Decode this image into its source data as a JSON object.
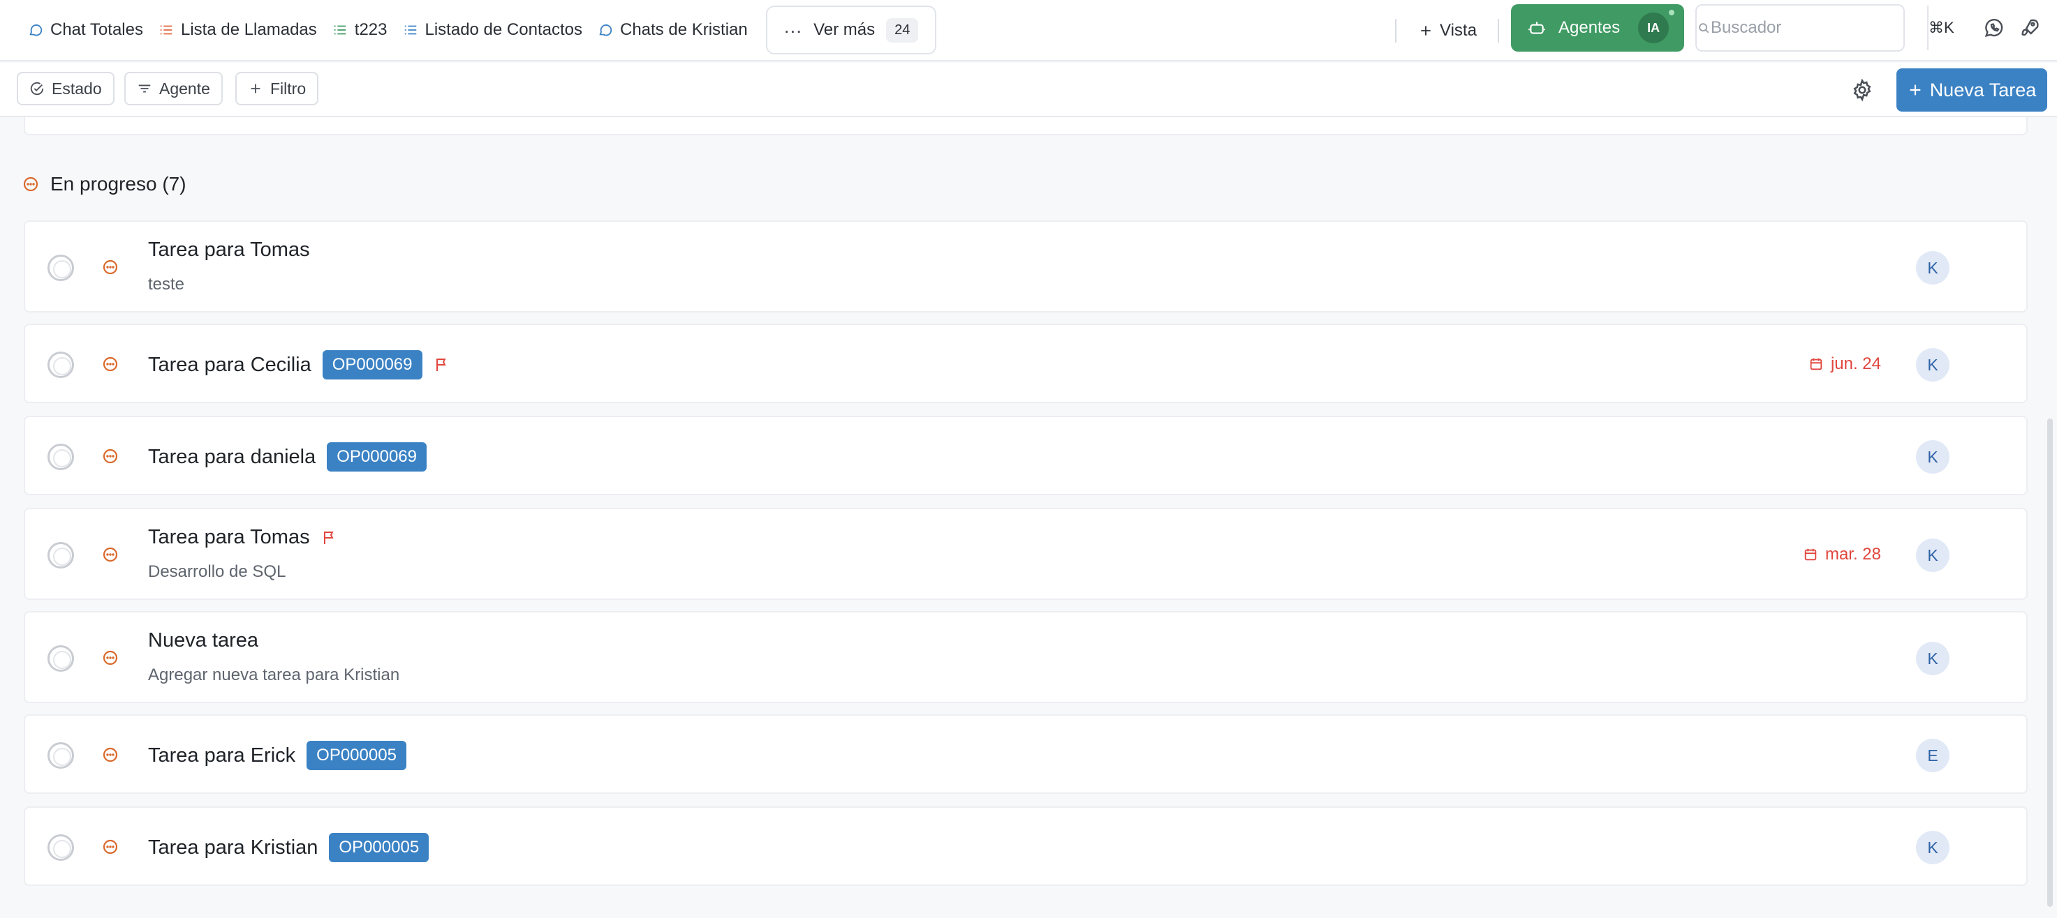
{
  "tabs": [
    {
      "label": "Chat Totales",
      "icon": "chat-icon",
      "color": "#3b82c4"
    },
    {
      "label": "Lista de Llamadas",
      "icon": "list-icon",
      "color": "#e0663e"
    },
    {
      "label": "t223",
      "icon": "list-icon",
      "color": "#3f9a63"
    },
    {
      "label": "Listado de Contactos",
      "icon": "list-icon",
      "color": "#3b82c4"
    },
    {
      "label": "Chats de Kristian",
      "icon": "chat-icon",
      "color": "#3b82c4"
    }
  ],
  "more": {
    "label": "Ver más",
    "count": "24"
  },
  "vista": {
    "label": "Vista"
  },
  "agentes": {
    "label": "Agentes",
    "badge": "IA"
  },
  "search": {
    "placeholder": "Buscador",
    "shortcut": "⌘K"
  },
  "filters": {
    "estado": "Estado",
    "agente": "Agente",
    "filtro": "Filtro"
  },
  "new_task": {
    "label": "Nueva Tarea"
  },
  "group": {
    "title": "En progreso (7)",
    "status_color": "#d9692b"
  },
  "tasks": [
    {
      "title": "Tarea para Tomas",
      "tag": "",
      "flag": false,
      "description": "teste",
      "date": "",
      "assignee": "K"
    },
    {
      "title": "Tarea para Cecilia",
      "tag": "OP000069",
      "flag": true,
      "description": "",
      "date": "jun. 24",
      "assignee": "K"
    },
    {
      "title": "Tarea para daniela",
      "tag": "OP000069",
      "flag": false,
      "description": "",
      "date": "",
      "assignee": "K"
    },
    {
      "title": "Tarea para Tomas",
      "tag": "",
      "flag": true,
      "description": "Desarrollo de SQL",
      "date": "mar. 28",
      "assignee": "K"
    },
    {
      "title": "Nueva tarea",
      "tag": "",
      "flag": false,
      "description": "Agregar nueva tarea para Kristian",
      "date": "",
      "assignee": "K"
    },
    {
      "title": "Tarea para Erick",
      "tag": "OP000005",
      "flag": false,
      "description": "",
      "date": "",
      "assignee": "E"
    },
    {
      "title": "Tarea para Kristian",
      "tag": "OP000005",
      "flag": false,
      "description": "",
      "date": "",
      "assignee": "K"
    }
  ],
  "colors": {
    "accent": "#3b82c4",
    "agentes": "#3f9a63",
    "date_overdue": "#e0463e",
    "in_progress": "#d9692b"
  }
}
